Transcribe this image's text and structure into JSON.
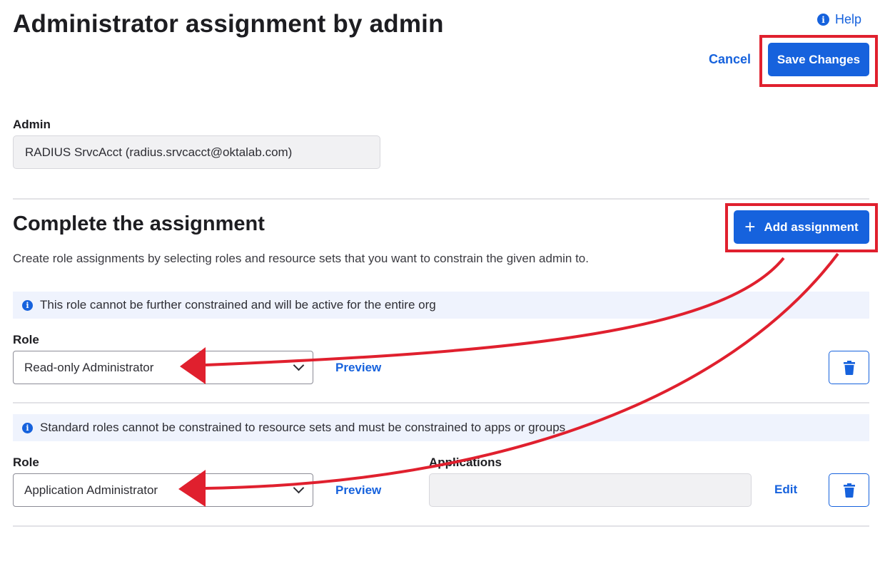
{
  "header": {
    "title": "Administrator assignment by admin",
    "help_label": "Help",
    "cancel_label": "Cancel",
    "save_label": "Save Changes"
  },
  "admin": {
    "label": "Admin",
    "value": "RADIUS SrvcAcct (radius.srvcacct@oktalab.com)"
  },
  "assignment_section": {
    "title": "Complete the assignment",
    "add_label": "Add assignment",
    "description": "Create role assignments by selecting roles and resource sets that you want to constrain the given admin to."
  },
  "assignments": [
    {
      "banner": "This role cannot be further constrained and will be active for the entire org",
      "role_label": "Role",
      "role_value": "Read-only Administrator",
      "preview_label": "Preview"
    },
    {
      "banner": "Standard roles cannot be constrained to resource sets and must be constrained to apps or groups",
      "role_label": "Role",
      "role_value": "Application Administrator",
      "preview_label": "Preview",
      "applications_label": "Applications",
      "applications_value": "",
      "edit_label": "Edit"
    }
  ],
  "colors": {
    "primary": "#1662dd",
    "annotation_red": "#e0202e",
    "banner_bg": "#eff3fd"
  },
  "icons": [
    "info-icon",
    "plus-icon",
    "chevron-down-icon",
    "trash-icon"
  ]
}
